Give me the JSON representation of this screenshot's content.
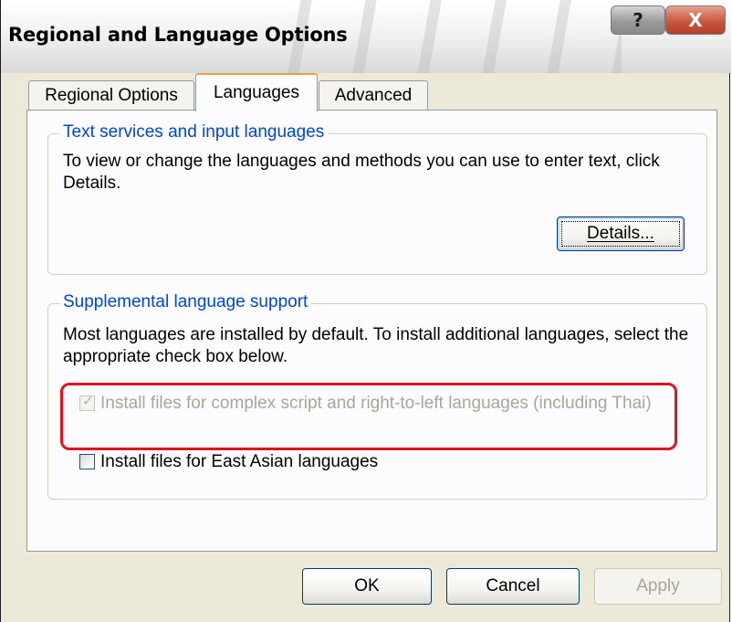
{
  "window": {
    "title": "Regional and Language Options",
    "help_label": "?",
    "close_label": "X"
  },
  "tabs": [
    {
      "label": "Regional Options",
      "active": false
    },
    {
      "label": "Languages",
      "active": true
    },
    {
      "label": "Advanced",
      "active": false
    }
  ],
  "text_services": {
    "legend": "Text services and input languages",
    "description": "To view or change the languages and methods you can use to enter text, click Details.",
    "details_button": "Details..."
  },
  "supplemental": {
    "legend": "Supplemental language support",
    "description": "Most languages are installed by default. To install additional languages, select the appropriate check box below.",
    "complex_script": {
      "label": "Install files for complex script and right-to-left languages (including Thai)",
      "checked": true,
      "disabled": true
    },
    "east_asian": {
      "label": "Install files for East Asian languages",
      "checked": false,
      "disabled": false
    }
  },
  "footer": {
    "ok": "OK",
    "cancel": "Cancel",
    "apply": "Apply"
  },
  "colors": {
    "highlight": "#e0141e",
    "legend_text": "#0046d5"
  }
}
